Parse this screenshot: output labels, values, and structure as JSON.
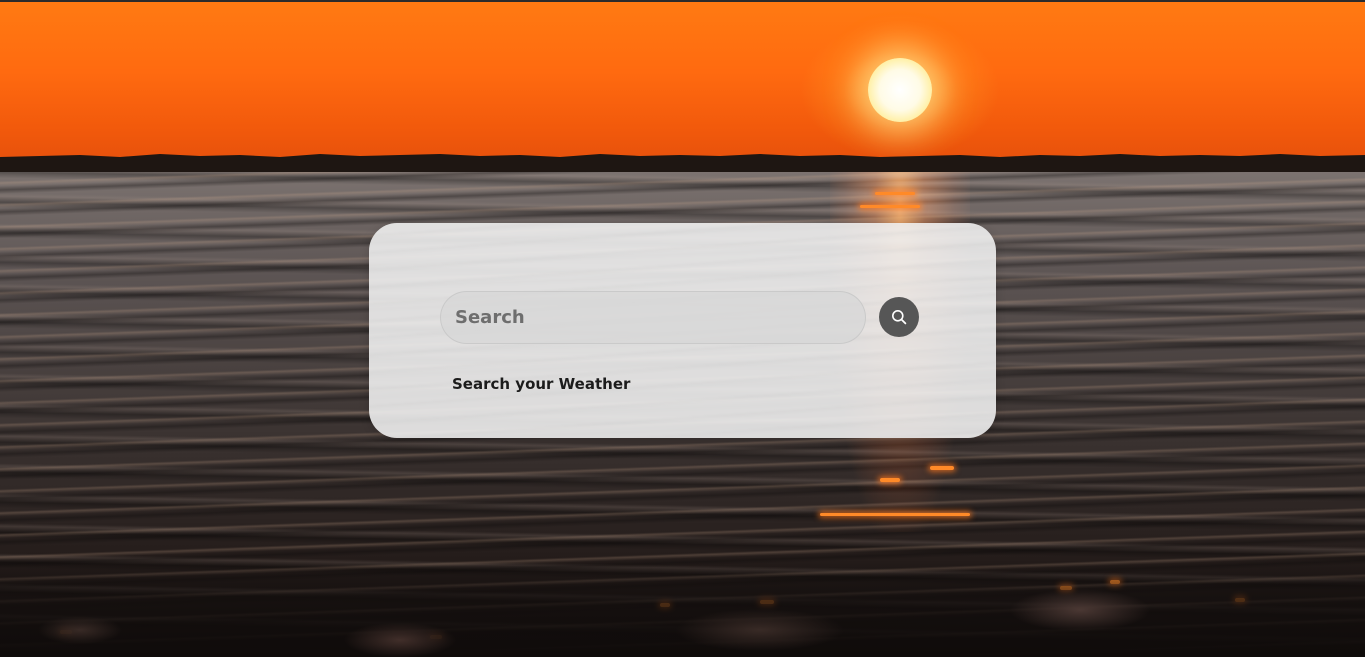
{
  "search": {
    "placeholder": "Search",
    "value": "",
    "button_icon": "search-icon"
  },
  "hint": {
    "text": "Search your Weather"
  },
  "colors": {
    "card_background": "#eeeeee",
    "button_background": "#565656",
    "sky_orange": "#ff6a10"
  }
}
